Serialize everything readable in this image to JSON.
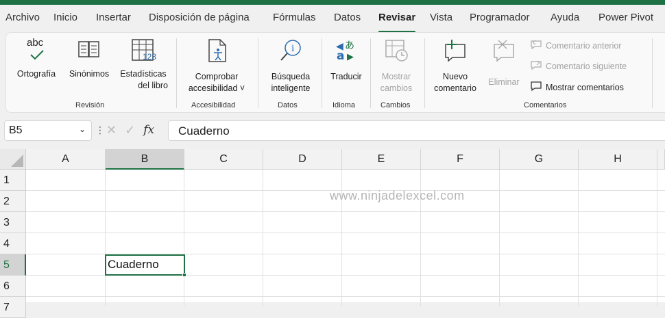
{
  "tabs": [
    "Archivo",
    "Inicio",
    "Insertar",
    "Disposición de página",
    "Fórmulas",
    "Datos",
    "Revisar",
    "Vista",
    "Programador",
    "Ayuda",
    "Power Pivot"
  ],
  "active_tab": "Revisar",
  "accent_color": "#1e7145",
  "ribbon": {
    "revision": {
      "group_label": "Revisión",
      "ortografia": "Ortografía",
      "ortografia_icon_text": "abc",
      "sinonimos": "Sinónimos",
      "estadisticas_1": "Estadísticas",
      "estadisticas_2": "del libro"
    },
    "accesibilidad": {
      "group_label": "Accesibilidad",
      "label_1": "Comprobar",
      "label_2": "accesibilidad ˅"
    },
    "datos": {
      "group_label": "Datos",
      "label_1": "Búsqueda",
      "label_2": "inteligente"
    },
    "idioma": {
      "group_label": "Idioma",
      "label": "Traducir"
    },
    "cambios": {
      "group_label": "Cambios",
      "label_1": "Mostrar",
      "label_2": "cambios"
    },
    "comentarios": {
      "group_label": "Comentarios",
      "nuevo_1": "Nuevo",
      "nuevo_2": "comentario",
      "eliminar": "Eliminar",
      "anterior": "Comentario anterior",
      "siguiente": "Comentario siguiente",
      "mostrar": "Mostrar comentarios"
    }
  },
  "formula_bar": {
    "name_box": "B5",
    "content": "Cuaderno"
  },
  "sheet": {
    "columns": [
      "A",
      "B",
      "C",
      "D",
      "E",
      "F",
      "G",
      "H"
    ],
    "rows": [
      "1",
      "2",
      "3",
      "4",
      "5",
      "6",
      "7"
    ],
    "selected_column": "B",
    "selected_row": "5",
    "cell_b5": "Cuaderno",
    "watermark": "www.ninjadelexcel.com"
  }
}
